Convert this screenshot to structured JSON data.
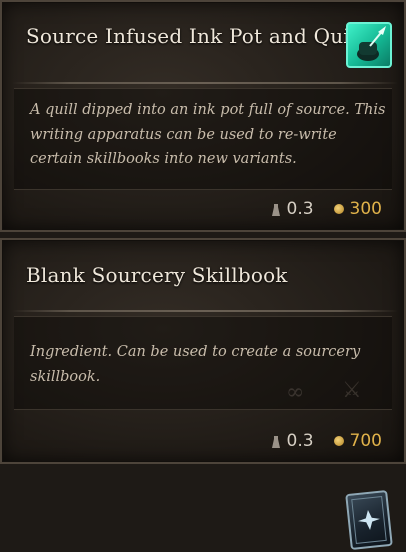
{
  "items": [
    {
      "title": "Source Infused Ink Pot and Quill",
      "description": "A quill dipped into an ink pot full of source. This writing apparatus can be used to re-write certain skillbooks into new variants.",
      "weight": "0.3",
      "value": "300",
      "icon": "ink-pot-quill-icon",
      "icon_color": "#2fe0b8"
    },
    {
      "title": "Blank Sourcery Skillbook",
      "description": "Ingredient. Can be used to create a sourcery skillbook.",
      "weight": "0.3",
      "value": "700",
      "icon": "skillbook-icon",
      "icon_color": "#8fa8b6"
    }
  ],
  "colors": {
    "title": "#efe7da",
    "description": "#c8bcab",
    "gold": "#e0b24a",
    "panel": "#221d18"
  }
}
